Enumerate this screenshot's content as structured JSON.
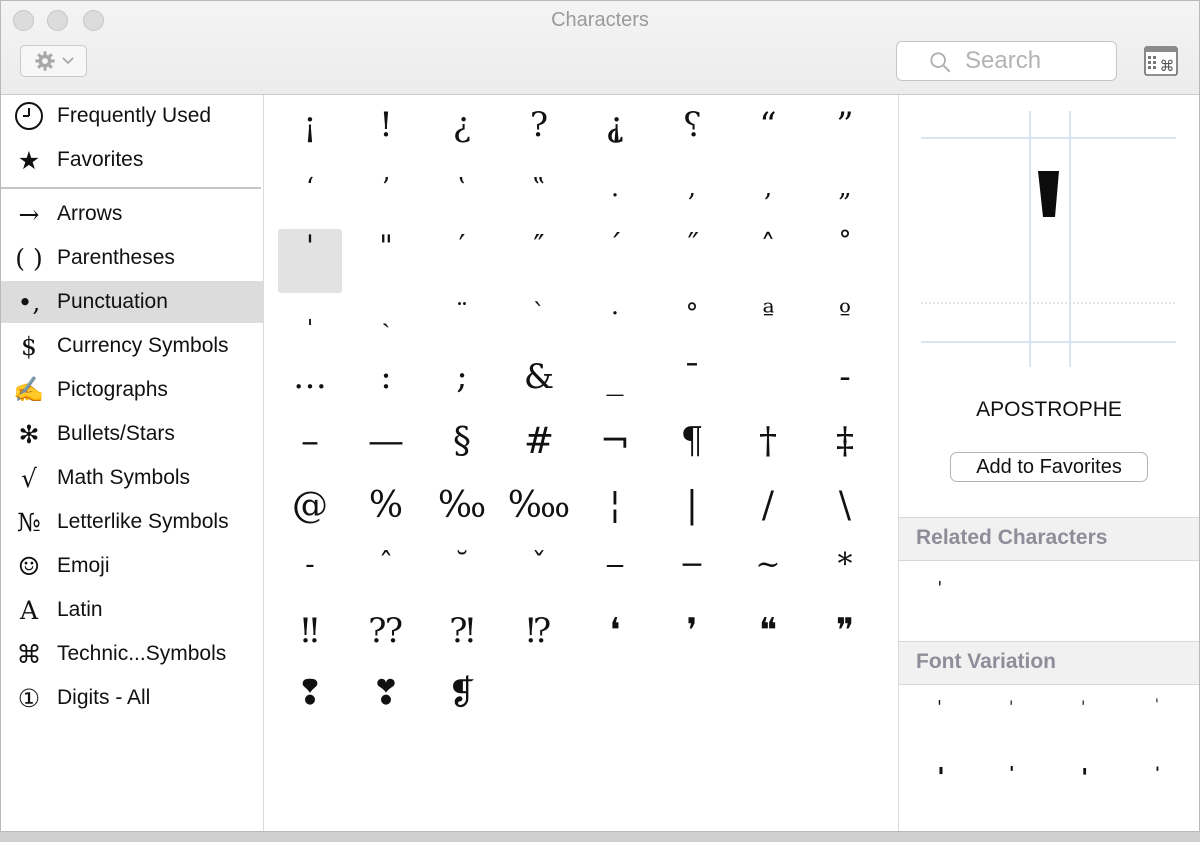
{
  "window": {
    "title": "Characters"
  },
  "toolbar": {
    "gear_icon": "gear-icon",
    "search_placeholder": "Search",
    "viewer_icon": "character-viewer-icon"
  },
  "sidebar": {
    "items": [
      {
        "label": "Frequently Used",
        "icon": "⌚",
        "icon_name": "clock-icon"
      },
      {
        "label": "Favorites",
        "icon": "★",
        "icon_name": "star-icon"
      },
      {
        "label": "Arrows",
        "icon": "→",
        "icon_name": "arrow-icon"
      },
      {
        "label": "Parentheses",
        "icon": "( )",
        "icon_name": "parentheses-icon"
      },
      {
        "label": "Punctuation",
        "icon": "•,",
        "icon_name": "punctuation-icon",
        "selected": true
      },
      {
        "label": "Currency Symbols",
        "icon": "$",
        "icon_name": "dollar-icon"
      },
      {
        "label": "Pictographs",
        "icon": "✍",
        "icon_name": "writing-hand-icon"
      },
      {
        "label": "Bullets/Stars",
        "icon": "✻",
        "icon_name": "asterisk-star-icon"
      },
      {
        "label": "Math Symbols",
        "icon": "√",
        "icon_name": "square-root-icon"
      },
      {
        "label": "Letterlike Symbols",
        "icon": "№",
        "icon_name": "numero-icon"
      },
      {
        "label": "Emoji",
        "icon": "☺",
        "icon_name": "smiley-icon"
      },
      {
        "label": "Latin",
        "icon": "A",
        "icon_name": "latin-letter-icon"
      },
      {
        "label": "Technic...Symbols",
        "icon": "⌘",
        "icon_name": "command-key-icon"
      },
      {
        "label": "Digits - All",
        "icon": "①",
        "icon_name": "circled-one-icon"
      }
    ]
  },
  "grid": {
    "selected_index": 16,
    "rows": [
      [
        "¡",
        "!",
        "¿",
        "?",
        "⸘",
        "⸮",
        "“",
        "”"
      ],
      [
        "‘",
        "’",
        "‛",
        "‟",
        ".",
        ",",
        "‚",
        "„"
      ],
      [
        "'",
        "\"",
        "′",
        "″",
        "´",
        "˝",
        "˄",
        "˚"
      ],
      [
        "ˌ",
        "ˏ",
        "¨",
        "`",
        "·",
        "°",
        "ª",
        "º"
      ],
      [
        "…",
        ":",
        ";",
        "&",
        "_",
        "¯",
        "",
        "‐"
      ],
      [
        "–",
        "—",
        "§",
        "#",
        "¬",
        "¶",
        "†",
        "‡"
      ],
      [
        "@",
        "%",
        "‰",
        "‱",
        "¦",
        "|",
        "/",
        "\\"
      ],
      [
        "˗",
        "ˆ",
        "˘",
        "ˇ",
        "‒",
        "−",
        "~",
        "*"
      ],
      [
        "‼",
        "⁇",
        "⁈",
        "⁉",
        "❛",
        "❜",
        "❝",
        "❞"
      ],
      [
        "❢",
        "❣",
        "❡"
      ]
    ]
  },
  "inspector": {
    "glyph": "'",
    "name": "APOSTROPHE",
    "add_favorites_label": "Add to Favorites",
    "related_header": "Related Characters",
    "related": [
      "ˈ"
    ],
    "variation_header": "Font Variation",
    "variations": [
      "'",
      "'",
      "'",
      "'",
      "'",
      "'",
      "'",
      "'"
    ]
  }
}
